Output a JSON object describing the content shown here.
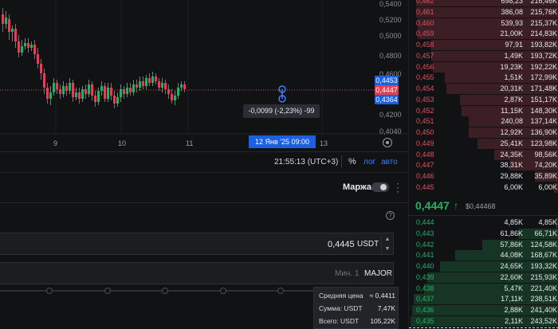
{
  "chart": {
    "price_scale": [
      "0,5400",
      "0,5200",
      "0,5000",
      "0,4800",
      "0,4600",
      "0,4200",
      "0,4040"
    ],
    "price_tags": [
      {
        "label": "0,4453",
        "color": "#1c5fe0"
      },
      {
        "label": "0,4447",
        "color": "#e0404f"
      },
      {
        "label": "0,4364",
        "color": "#1c5fe0"
      }
    ],
    "dates": [
      "9",
      "10",
      "11",
      "13"
    ],
    "highlight_date": "12 Янв '25   09:00",
    "measure_label": "-0,0099 (-2,23%) -99",
    "up_color": "#22b069",
    "down_color": "#e0405f"
  },
  "toolbar": {
    "clock": "21:55:13 (UTC+3)",
    "percent": "%",
    "log": "лог",
    "auto": "авто"
  },
  "margin": {
    "label": "Маржа"
  },
  "help_icon": "?",
  "price_input": {
    "value": "0,4445",
    "unit": "USDT",
    "up": "▲",
    "down": "▼"
  },
  "qty_input": {
    "min": "Мин. 1",
    "unit": "MAJOR"
  },
  "tooltip": {
    "rows": [
      {
        "k": "Средняя цена",
        "v": "≈ 0,4411"
      },
      {
        "k": "Сумма: USDT",
        "v": "7,47K"
      },
      {
        "k": "Всего: USDT",
        "v": "105,22K"
      }
    ]
  },
  "book": {
    "asks": [
      {
        "price": "0,462",
        "amount": "698,23",
        "total": "216,46K",
        "depth": 0.95
      },
      {
        "price": "0,461",
        "amount": "386,08",
        "total": "215,76K",
        "depth": 0.95
      },
      {
        "price": "0,460",
        "amount": "539,93",
        "total": "215,37K",
        "depth": 0.94
      },
      {
        "price": "0,459",
        "amount": "21,00K",
        "total": "214,83K",
        "depth": 0.94
      },
      {
        "price": "0,458",
        "amount": "97,91",
        "total": "193,82K",
        "depth": 0.85
      },
      {
        "price": "0,457",
        "amount": "1,49K",
        "total": "193,72K",
        "depth": 0.85
      },
      {
        "price": "0,456",
        "amount": "19,23K",
        "total": "192,22K",
        "depth": 0.84
      },
      {
        "price": "0,455",
        "amount": "1,51K",
        "total": "172,99K",
        "depth": 0.76
      },
      {
        "price": "0,454",
        "amount": "20,31K",
        "total": "171,48K",
        "depth": 0.75
      },
      {
        "price": "0,453",
        "amount": "2,87K",
        "total": "151,17K",
        "depth": 0.66
      },
      {
        "price": "0,452",
        "amount": "11,15K",
        "total": "148,30K",
        "depth": 0.65
      },
      {
        "price": "0,451",
        "amount": "240,08",
        "total": "137,14K",
        "depth": 0.6
      },
      {
        "price": "0,450",
        "amount": "12,92K",
        "total": "136,90K",
        "depth": 0.6
      },
      {
        "price": "0,449",
        "amount": "25,41K",
        "total": "123,98K",
        "depth": 0.54
      },
      {
        "price": "0,448",
        "amount": "24,35K",
        "total": "98,56K",
        "depth": 0.43
      },
      {
        "price": "0,447",
        "amount": "38,31K",
        "total": "74,20K",
        "depth": 0.33
      },
      {
        "price": "0,446",
        "amount": "29,88K",
        "total": "35,89K",
        "depth": 0.16
      },
      {
        "price": "0,445",
        "amount": "6,00K",
        "total": "6,00K",
        "depth": 0.03
      }
    ],
    "mid": {
      "price": "0,4447",
      "arrow": "↑",
      "mark": "$0,44468"
    },
    "bids": [
      {
        "price": "0,444",
        "amount": "4,85K",
        "total": "4,85K",
        "depth": 0.02
      },
      {
        "price": "0,443",
        "amount": "61,86K",
        "total": "66,71K",
        "depth": 0.27
      },
      {
        "price": "0,442",
        "amount": "57,86K",
        "total": "124,58K",
        "depth": 0.51
      },
      {
        "price": "0,441",
        "amount": "44,08K",
        "total": "168,67K",
        "depth": 0.69
      },
      {
        "price": "0,440",
        "amount": "24,65K",
        "total": "193,32K",
        "depth": 0.79
      },
      {
        "price": "0,439",
        "amount": "22,60K",
        "total": "215,93K",
        "depth": 0.88
      },
      {
        "price": "0,438",
        "amount": "5,47K",
        "total": "221,40K",
        "depth": 0.9
      },
      {
        "price": "0,437",
        "amount": "17,11K",
        "total": "238,51K",
        "depth": 0.97
      },
      {
        "price": "0,436",
        "amount": "2,88K",
        "total": "241,40K",
        "depth": 0.98
      },
      {
        "price": "0,435",
        "amount": "2,11K",
        "total": "243,52K",
        "depth": 0.99
      }
    ]
  }
}
